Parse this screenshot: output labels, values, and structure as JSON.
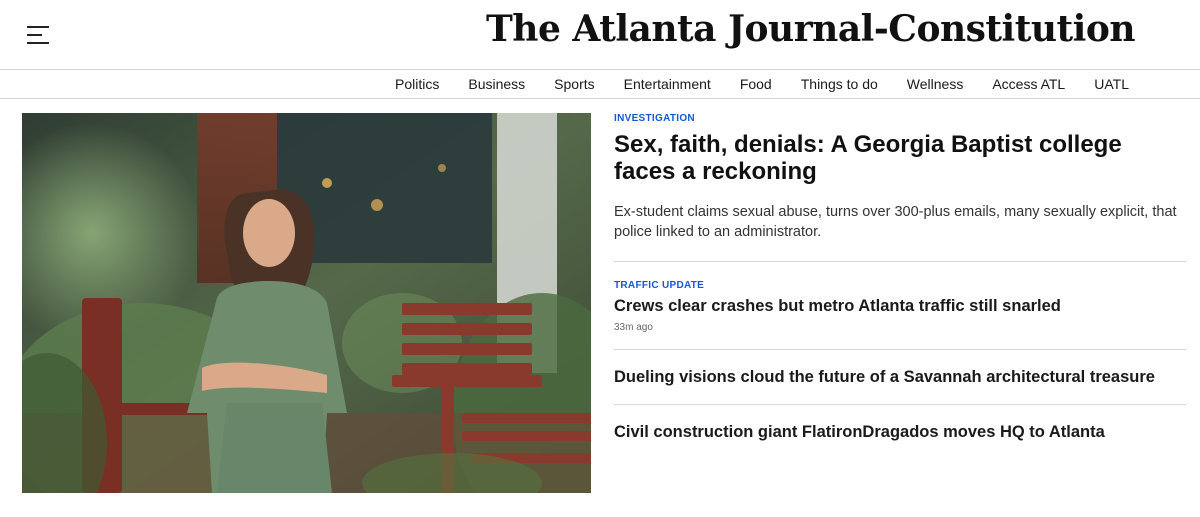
{
  "header": {
    "menu_icon": "hamburger-menu-icon",
    "logo_text": "The Atlanta Journal-Constitution"
  },
  "nav": {
    "items": [
      "Politics",
      "Business",
      "Sports",
      "Entertainment",
      "Food",
      "Things to do",
      "Wellness",
      "Access ATL",
      "UATL"
    ]
  },
  "lead": {
    "kicker": "INVESTIGATION",
    "title": "Sex, faith, denials: A Georgia Baptist college faces a reckoning",
    "description": "Ex-student claims sexual abuse, turns over 300-plus emails, many sexually explicit, that police linked to an administrator."
  },
  "stories": [
    {
      "kicker": "TRAFFIC UPDATE",
      "title": "Crews clear crashes but metro Atlanta traffic still snarled",
      "timestamp": "33m ago"
    },
    {
      "title": "Dueling visions cloud the future of a Savannah architectural treasure"
    },
    {
      "title": "Civil construction giant FlatironDragados moves HQ to Atlanta"
    }
  ],
  "colors": {
    "kicker": "#1558d6",
    "divider": "#d8d8d8"
  }
}
